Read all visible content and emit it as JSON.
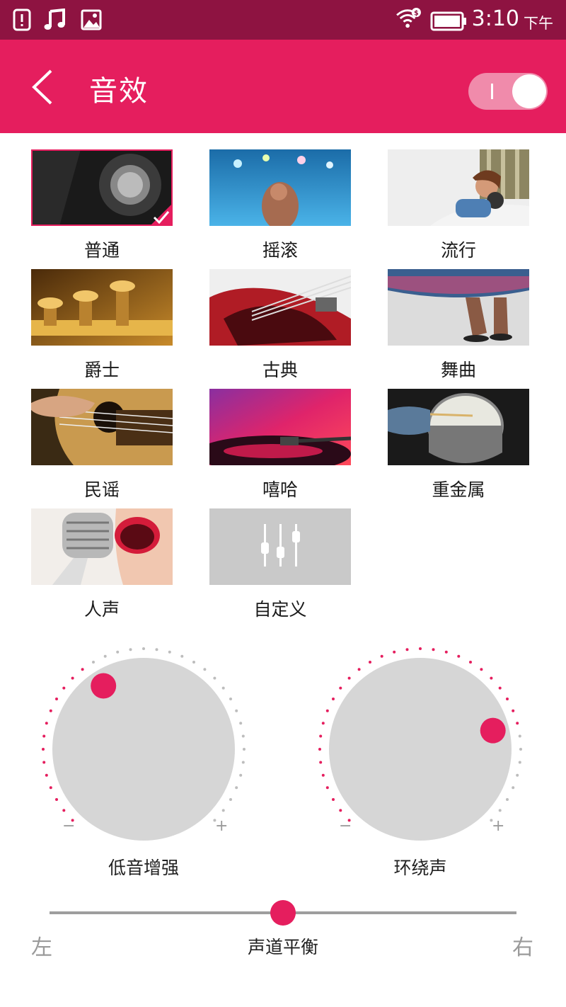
{
  "status_bar": {
    "time": "3:10",
    "ampm": "下午",
    "icons": [
      "notification-icon",
      "music-icon",
      "image-icon",
      "wifi-icon",
      "battery-icon"
    ]
  },
  "app_bar": {
    "title": "音效",
    "toggle_state": "on",
    "toggle_mark": "I"
  },
  "presets": [
    {
      "label": "普通",
      "selected": true
    },
    {
      "label": "摇滚",
      "selected": false
    },
    {
      "label": "流行",
      "selected": false
    },
    {
      "label": "爵士",
      "selected": false
    },
    {
      "label": "古典",
      "selected": false
    },
    {
      "label": "舞曲",
      "selected": false
    },
    {
      "label": "民谣",
      "selected": false
    },
    {
      "label": "嘻哈",
      "selected": false
    },
    {
      "label": "重金属",
      "selected": false
    },
    {
      "label": "人声",
      "selected": false
    },
    {
      "label": "自定义",
      "selected": false
    }
  ],
  "knobs": {
    "bass": {
      "label": "低音增强",
      "minus": "−",
      "plus": "+",
      "level_fraction": 0.38
    },
    "surround": {
      "label": "环绕声",
      "minus": "−",
      "plus": "+",
      "level_fraction": 0.78
    }
  },
  "balance": {
    "label": "声道平衡",
    "left": "左",
    "right": "右",
    "value_fraction": 0.5
  },
  "colors": {
    "accent": "#e51e5e",
    "status_bar": "#8e1341",
    "knob_face": "#d6d6d6",
    "dots_inactive": "#bdbdbd"
  }
}
